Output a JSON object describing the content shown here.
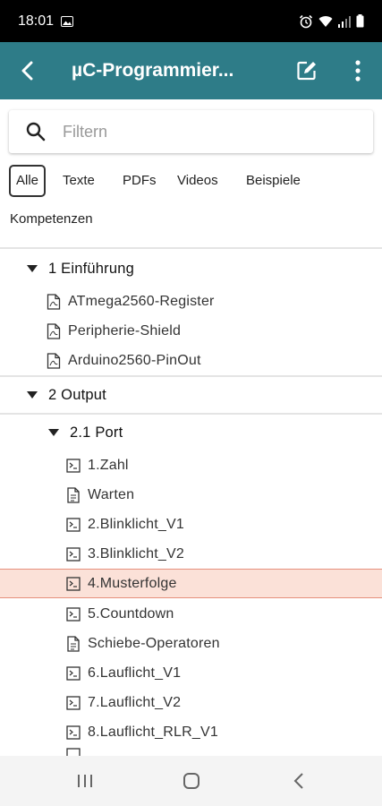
{
  "status_bar": {
    "time": "18:01"
  },
  "app_bar": {
    "title": "µC-Programmier..."
  },
  "search": {
    "placeholder": "Filtern"
  },
  "filters": [
    "Alle",
    "Texte",
    "PDFs",
    "Videos",
    "Beispiele",
    "Kompetenzen"
  ],
  "active_filter": "Alle",
  "tree": {
    "s1": "1 Einführung",
    "s1_items": [
      "ATmega2560-Register",
      "Peripherie-Shield",
      "Arduino2560-PinOut"
    ],
    "s2": "2 Output",
    "s2_1": "2.1 Port",
    "s2_1_items": [
      "1.Zahl",
      "Warten",
      "2.Blinklicht_V1",
      "3.Blinklicht_V2",
      "4.Musterfolge",
      "5.Countdown",
      "Schiebe-Operatoren",
      "6.Lauflicht_V1",
      "7.Lauflicht_V2",
      "8.Lauflicht_RLR_V1"
    ],
    "selected_item": "4.Musterfolge"
  },
  "colors": {
    "app_bar": "#2e7c88",
    "highlight_bg": "#fbe1d8",
    "highlight_border": "#e68f7c"
  }
}
